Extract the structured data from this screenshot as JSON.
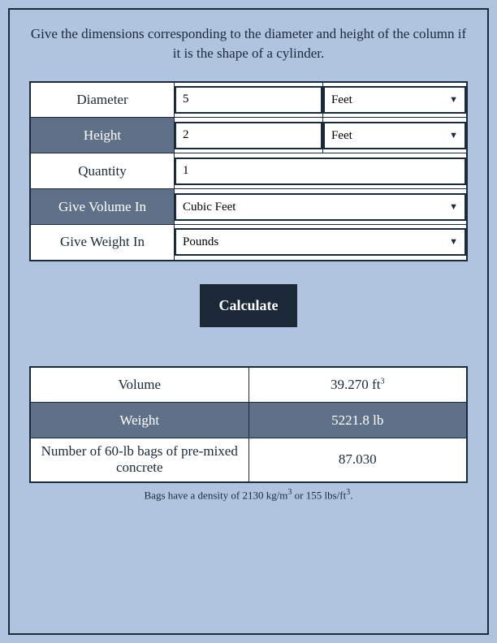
{
  "instructions": "Give the dimensions corresponding to the diameter and height of the column if it is the shape of a cylinder.",
  "inputs": {
    "diameter": {
      "label": "Diameter",
      "value": "5",
      "unit": "Feet"
    },
    "height": {
      "label": "Height",
      "value": "2",
      "unit": "Feet"
    },
    "quantity": {
      "label": "Quantity",
      "value": "1"
    },
    "volumeIn": {
      "label": "Give Volume In",
      "value": "Cubic Feet"
    },
    "weightIn": {
      "label": "Give Weight In",
      "value": "Pounds"
    }
  },
  "calculate": "Calculate",
  "results": {
    "volume": {
      "label": "Volume",
      "value": "39.270 ft",
      "sup": "3"
    },
    "weight": {
      "label": "Weight",
      "value": "5221.8 lb"
    },
    "bags": {
      "label": "Number of 60-lb bags of pre-mixed concrete",
      "value": "87.030"
    }
  },
  "footnote": {
    "pre": "Bags have a density of 2130 kg/m",
    "mid": " or 155 lbs/ft",
    "end": "."
  }
}
